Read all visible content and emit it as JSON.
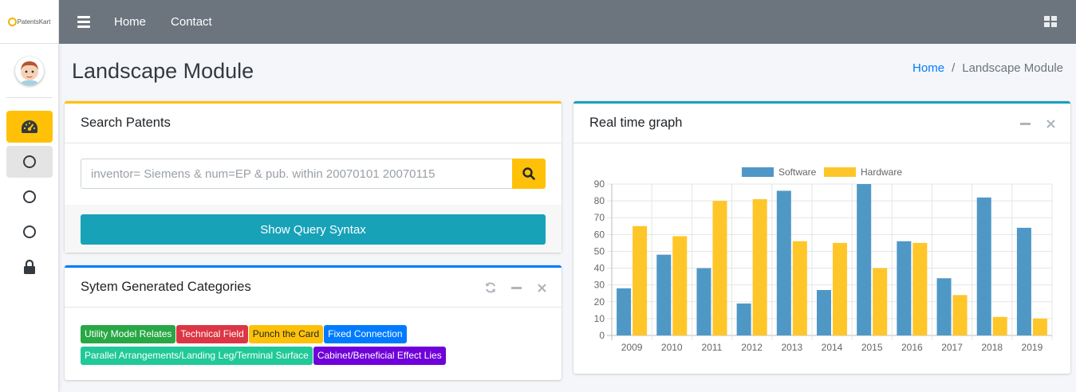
{
  "brand": {
    "name": "PatentsKart"
  },
  "topbar": {
    "links": [
      "Home",
      "Contact"
    ]
  },
  "page": {
    "title": "Landscape Module"
  },
  "breadcrumb": {
    "home": "Home",
    "separator": "/",
    "current": "Landscape Module"
  },
  "search_card": {
    "title": "Search Patents",
    "placeholder": "inventor= Siemens & num=EP & pub. within 20070101 20070115",
    "syntax_button": "Show Query Syntax"
  },
  "categories_card": {
    "title": "Sytem Generated Categories",
    "tags": [
      {
        "label": "Utility Model Relates",
        "color": "#28a745",
        "text_color": "#ffffff"
      },
      {
        "label": "Technical Field",
        "color": "#dc3545",
        "text_color": "#ffffff"
      },
      {
        "label": "Punch the Card",
        "color": "#ffc107",
        "text_color": "#212529"
      },
      {
        "label": "Fixed Connection",
        "color": "#007bff",
        "text_color": "#ffffff"
      },
      {
        "label": "Parallel Arrangements/Landing Leg/Terminal Surface",
        "color": "#20c997",
        "text_color": "#ffffff"
      },
      {
        "label": "Cabinet/Beneficial Effect Lies",
        "color": "#6f00d9",
        "text_color": "#ffffff"
      }
    ]
  },
  "graph_card": {
    "title": "Real time graph"
  },
  "colors": {
    "sidebar_active": "#ffc107",
    "topbar": "#6c757d",
    "software": "#4f98c6",
    "hardware": "#ffc629"
  },
  "chart_data": {
    "type": "bar",
    "categories": [
      "2009",
      "2010",
      "2011",
      "2012",
      "2013",
      "2014",
      "2015",
      "2016",
      "2017",
      "2018",
      "2019"
    ],
    "series": [
      {
        "name": "Software",
        "values": [
          28,
          48,
          40,
          19,
          86,
          27,
          90,
          56,
          34,
          82,
          64
        ]
      },
      {
        "name": "Hardware",
        "values": [
          65,
          59,
          80,
          81,
          56,
          55,
          40,
          55,
          24,
          11,
          10
        ]
      }
    ],
    "ylim": [
      0,
      90
    ],
    "yticks": [
      0,
      10,
      20,
      30,
      40,
      50,
      60,
      70,
      80,
      90
    ],
    "grid": true,
    "legend": "top-center"
  }
}
